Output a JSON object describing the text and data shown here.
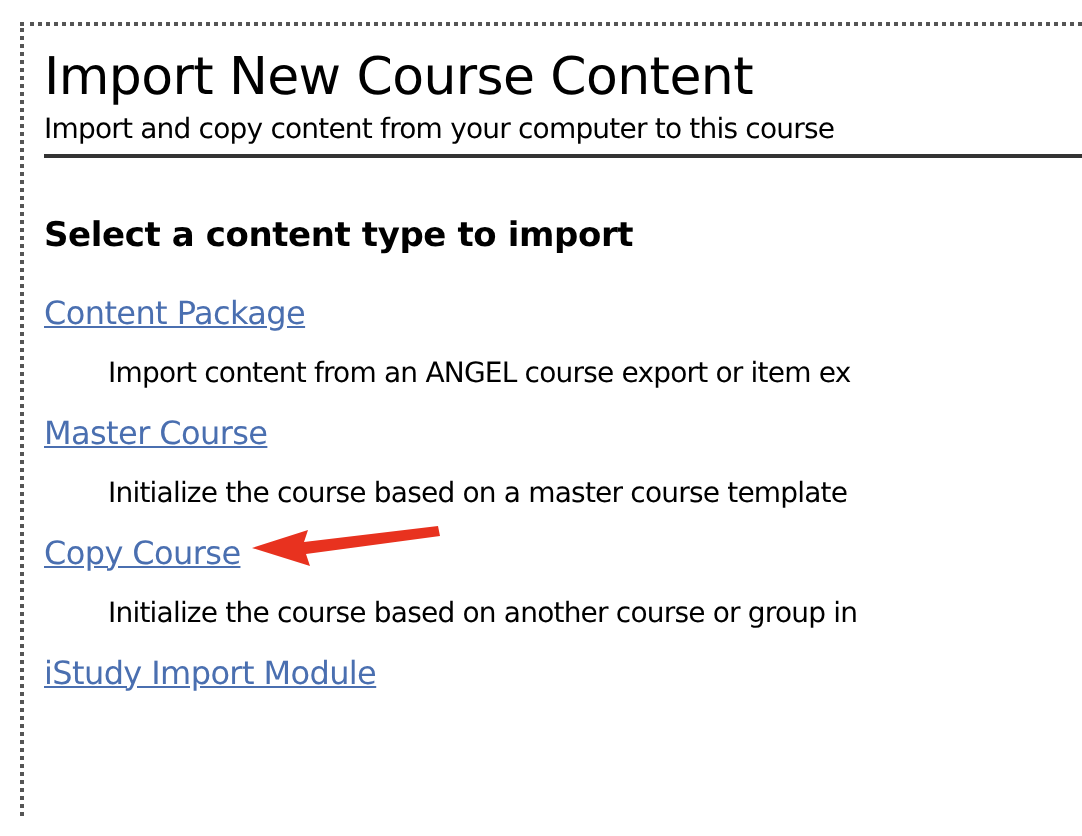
{
  "page": {
    "title": "Import New Course Content",
    "subtitle": "Import and copy content from your computer to this course"
  },
  "section": {
    "heading": "Select a content type to import"
  },
  "options": [
    {
      "label": "Content Package",
      "description": "Import content from an ANGEL course export or item ex",
      "highlighted": false
    },
    {
      "label": "Master Course",
      "description": "Initialize the course based on a master course template",
      "highlighted": false
    },
    {
      "label": "Copy Course",
      "description": "Initialize the course based on another course or group in",
      "highlighted": true
    },
    {
      "label": "iStudy Import Module",
      "highlighted": false
    }
  ]
}
